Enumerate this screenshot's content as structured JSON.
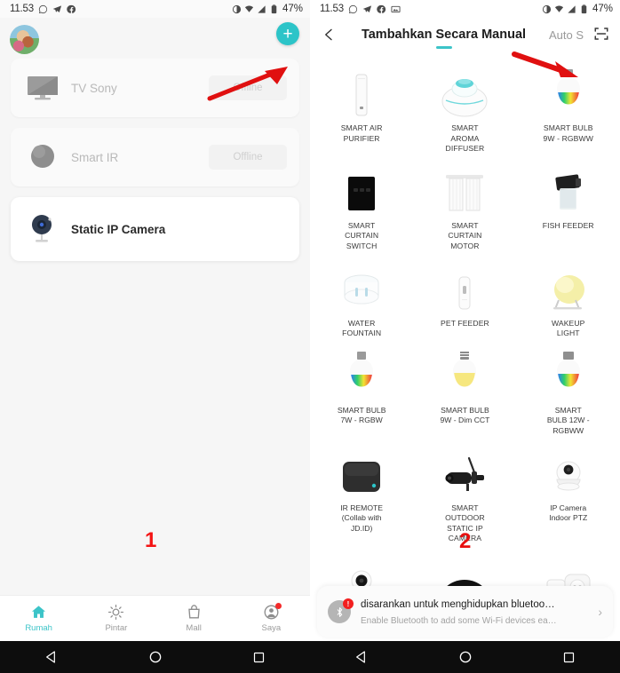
{
  "status_bar": {
    "time": "11.53",
    "left_icons": [
      "whatsapp-icon",
      "telegram-icon",
      "facebook-icon"
    ],
    "left_icons_right_panel": [
      "whatsapp-icon",
      "telegram-icon",
      "facebook-icon",
      "screenshot-icon"
    ],
    "right_icons": [
      "eye-icon",
      "wifi-icon",
      "signal-icon",
      "battery-icon"
    ],
    "battery": "47%"
  },
  "colors": {
    "accent_teal": "#3cc4c8",
    "fab_teal": "#2cc4c8",
    "annotation_red": "#ee1111",
    "badge_red": "#f42b2b",
    "panel_bg": "#f6f6f6",
    "card_bg": "#fafafa",
    "muted_text": "#b9b9b9"
  },
  "left_panel": {
    "avatar": "user-avatar",
    "add_button_label": "+",
    "annotation_marker": "1",
    "devices": [
      {
        "name": "TV Sony",
        "status": "Offline",
        "icon": "tv-icon",
        "active": false
      },
      {
        "name": "Smart IR",
        "status": "Offline",
        "icon": "ir-blaster-icon",
        "active": false
      },
      {
        "name": "Static IP Camera",
        "status": "",
        "icon": "ip-camera-icon",
        "active": true
      }
    ],
    "tabs": [
      {
        "label": "Rumah",
        "icon": "home-icon",
        "active": true,
        "badge": false
      },
      {
        "label": "Pintar",
        "icon": "smart-scene-icon",
        "active": false,
        "badge": false
      },
      {
        "label": "Mall",
        "icon": "shopping-bag-icon",
        "active": false,
        "badge": false
      },
      {
        "label": "Saya",
        "icon": "profile-icon",
        "active": false,
        "badge": true
      }
    ]
  },
  "right_panel": {
    "header": {
      "back_icon": "chevron-left-icon",
      "title": "Tambahkan Secara Manual",
      "auto_scan_label": "Auto S",
      "scan_icon": "qr-scan-icon"
    },
    "annotation_marker": "2",
    "device_grid": [
      [
        {
          "label": "SMART AIR\nPURIFIER",
          "icon": "air-purifier-icon"
        },
        {
          "label": "SMART\nAROMA\nDIFFUSER",
          "icon": "aroma-diffuser-icon"
        },
        {
          "label": "SMART BULB\n9W - RGBWW",
          "icon": "rgb-bulb-icon"
        }
      ],
      [
        {
          "label": "SMART\nCURTAIN\nSWITCH",
          "icon": "curtain-switch-icon"
        },
        {
          "label": "SMART\nCURTAIN\nMOTOR",
          "icon": "curtain-motor-icon"
        },
        {
          "label": "FISH FEEDER",
          "icon": "fish-feeder-icon"
        }
      ],
      [
        {
          "label": "WATER\nFOUNTAIN",
          "icon": "water-fountain-icon"
        },
        {
          "label": "PET FEEDER",
          "icon": "pet-feeder-icon"
        },
        {
          "label": "WAKEUP\nLIGHT",
          "icon": "wakeup-light-icon"
        }
      ],
      [
        {
          "label": "SMART BULB\n7W - RGBW",
          "icon": "rgb-bulb-icon"
        },
        {
          "label": "SMART BULB\n9W - Dim CCT",
          "icon": "cct-bulb-icon"
        },
        {
          "label": "SMART\nBULB 12W -\nRGBWW",
          "icon": "rgb-bulb-icon"
        }
      ],
      [
        {
          "label": "IR REMOTE\n(Collab with\nJD.ID)",
          "icon": "ir-remote-icon"
        },
        {
          "label": "SMART\nOUTDOOR\nSTATIC IP\nCAMERA",
          "icon": "outdoor-camera-icon"
        },
        {
          "label": "IP Camera\nIndoor PTZ",
          "icon": "ptz-camera-icon"
        }
      ],
      [
        {
          "label": "",
          "icon": "mini-camera-icon"
        },
        {
          "label": "",
          "icon": "speaker-icon"
        },
        {
          "label": "",
          "icon": "smart-plug-icon"
        }
      ]
    ],
    "bluetooth_banner": {
      "badge": "!",
      "title": "disarankan untuk menghidupkan bluetoo…",
      "subtitle": "Enable Bluetooth to add some Wi-Fi devices ea…",
      "chevron": "›",
      "icon": "bluetooth-icon"
    }
  },
  "android_nav": {
    "back": "back-triangle-icon",
    "home": "home-circle-icon",
    "recents": "recents-square-icon"
  }
}
